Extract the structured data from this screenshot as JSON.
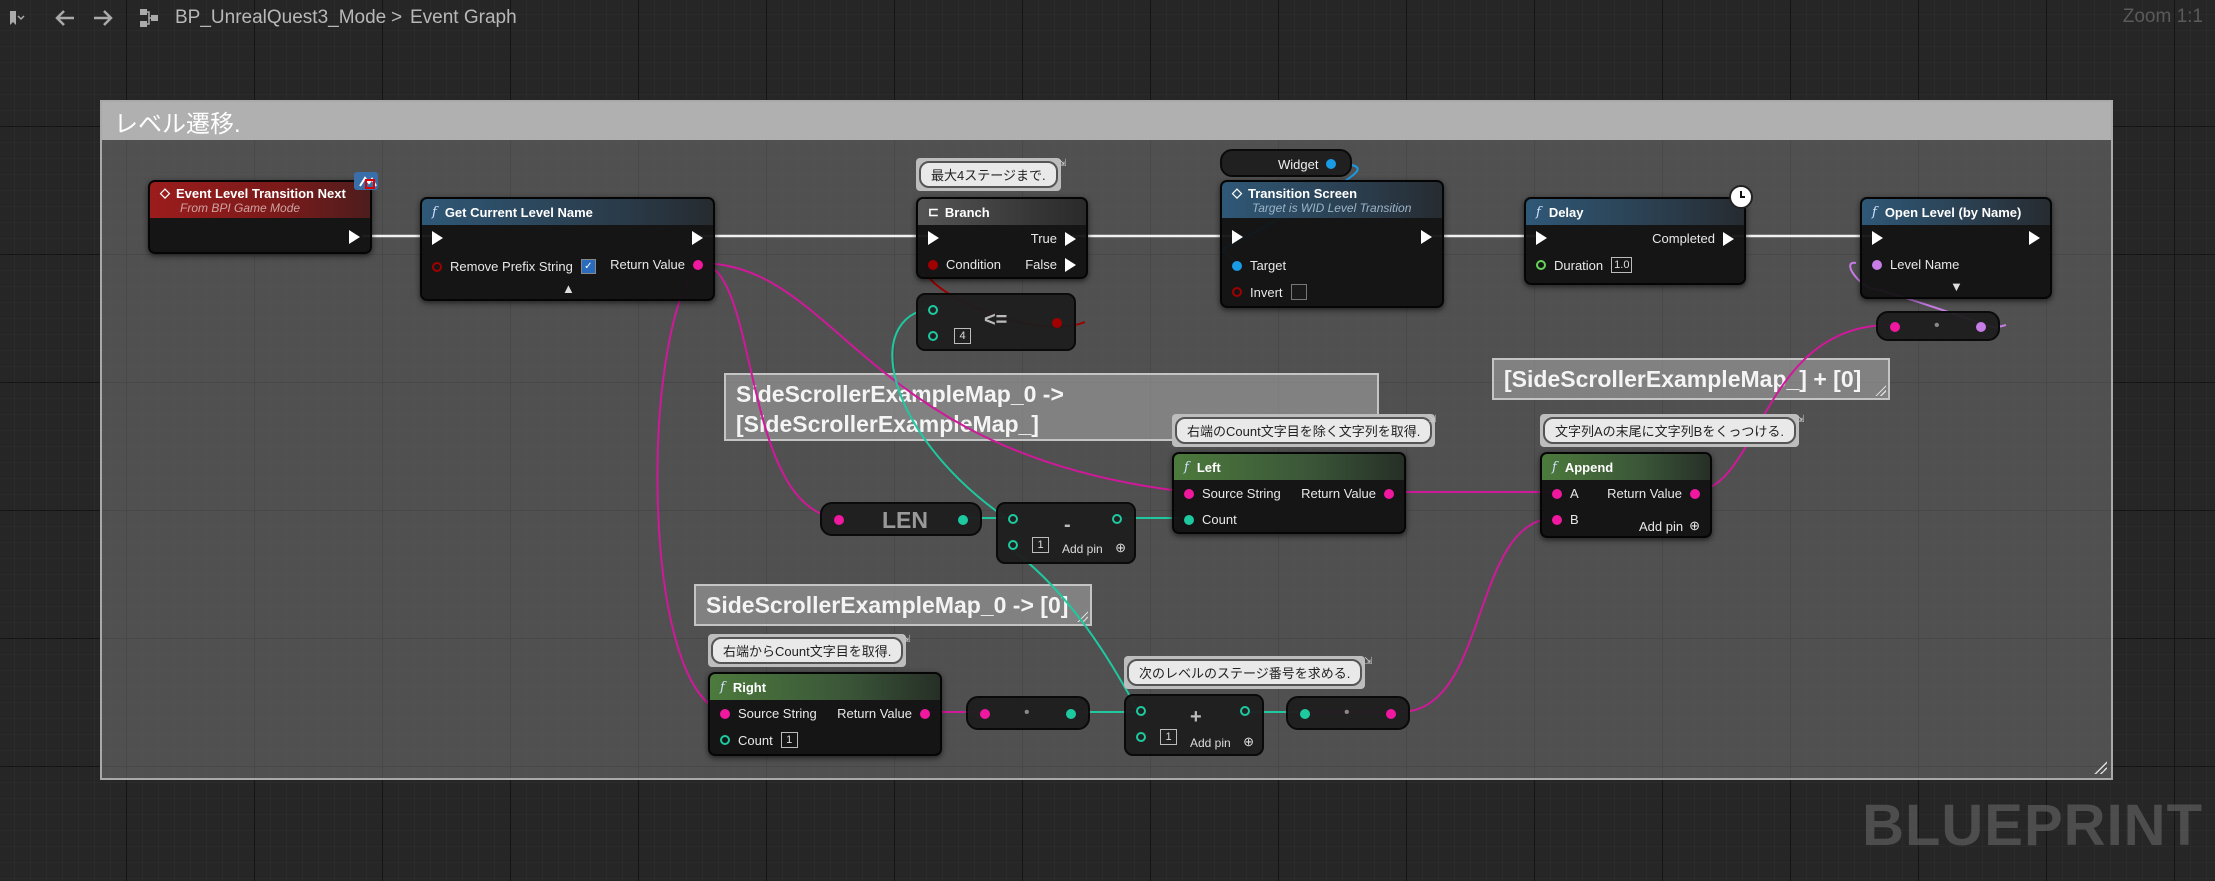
{
  "toolbar": {
    "breadcrumb_root": "BP_UnrealQuest3_Mode",
    "breadcrumb_sep": ">",
    "breadcrumb_leaf": "Event Graph",
    "zoom": "Zoom 1:1"
  },
  "watermark": "BLUEPRINT",
  "comment_main": "レベル遷移.",
  "comment_a": "SideScrollerExampleMap_0 ->\n[SideScrollerExampleMap_]",
  "comment_a_line1": "SideScrollerExampleMap_0 ->",
  "comment_a_line2": "[SideScrollerExampleMap_]",
  "comment_b": "SideScrollerExampleMap_0 -> [0]",
  "comment_c": "[SideScrollerExampleMap_] + [0]",
  "bubbles": {
    "branch": "最大4ステージまで.",
    "left": "右端のCount文字目を除く文字列を取得.",
    "append": "文字列Aの末尾に文字列Bをくっつける.",
    "right": "右端からCount文字目を取得.",
    "add": "次のレベルのステージ番号を求める."
  },
  "nodes": {
    "event": {
      "title": "Event Level Transition Next",
      "subtitle": "From BPI Game Mode"
    },
    "get_level": {
      "title": "Get Current Level Name",
      "pin_in": "Remove Prefix String",
      "pin_out": "Return Value"
    },
    "branch": {
      "title": "Branch",
      "pin_cond": "Condition",
      "pin_true": "True",
      "pin_false": "False"
    },
    "compare": {
      "op": "<=",
      "value": "4"
    },
    "widget_var": {
      "label": "Widget"
    },
    "transition": {
      "title": "Transition Screen",
      "subtitle": "Target is WID Level Transition",
      "pin_target": "Target",
      "pin_invert": "Invert"
    },
    "delay": {
      "title": "Delay",
      "pin_completed": "Completed",
      "pin_duration": "Duration",
      "duration_value": "1.0"
    },
    "open_level": {
      "title": "Open Level (by Name)",
      "pin_level": "Level Name"
    },
    "len": {
      "label": "LEN"
    },
    "subtract": {
      "op": "-",
      "value": "1",
      "add_pin": "Add pin"
    },
    "left": {
      "title": "Left",
      "pin_source": "Source String",
      "pin_count": "Count",
      "pin_out": "Return Value"
    },
    "append": {
      "title": "Append",
      "pin_a": "A",
      "pin_b": "B",
      "pin_out": "Return Value",
      "add_pin": "Add pin"
    },
    "right": {
      "title": "Right",
      "pin_source": "Source String",
      "pin_count": "Count",
      "pin_out": "Return Value",
      "count_value": "1"
    },
    "add": {
      "op": "+",
      "value": "1",
      "add_pin": "Add pin"
    }
  },
  "colors": {
    "string_pin": "#f0189f",
    "int_pin": "#1ec9a0",
    "bool_pin": "#a10000",
    "object_pin": "#1a9be6",
    "float_pin": "#65d65a",
    "name_pin": "#c87ce6",
    "event_header": "#9b1c1c",
    "function_header": "#2f5877",
    "pure_header": "#4c7a3c"
  },
  "icons": [
    "bookmark-icon",
    "back-arrow-icon",
    "forward-arrow-icon",
    "blueprint-graph-icon",
    "function-icon",
    "event-icon",
    "branch-icon",
    "clock-icon",
    "exec-pin-icon",
    "add-pin-icon",
    "check-icon",
    "pushpin-icon",
    "interface-icon"
  ]
}
